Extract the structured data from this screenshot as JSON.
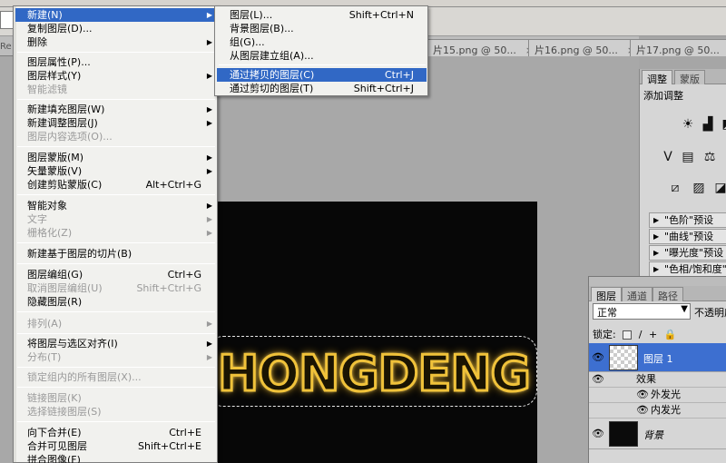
{
  "doc_tabs": [
    {
      "label": "片15.png @ 50...",
      "close": "×"
    },
    {
      "label": "片16.png @ 50...",
      "close": "×"
    },
    {
      "label": "片17.png @ 50...",
      "close": "×"
    }
  ],
  "ed_mark": "Re",
  "canvas": {
    "text": "HONGDENG"
  },
  "menu": {
    "items": [
      {
        "label": "新建(N)",
        "arrow": "▶"
      },
      {
        "label": "复制图层(D)..."
      },
      {
        "label": "删除",
        "arrow": "▶"
      },
      {
        "label": "图层属性(P)..."
      },
      {
        "label": "图层样式(Y)",
        "arrow": "▶"
      },
      {
        "label": "智能滤镜"
      },
      {
        "label": "新建填充图层(W)",
        "arrow": "▶"
      },
      {
        "label": "新建调整图层(J)",
        "arrow": "▶"
      },
      {
        "label": "图层内容选项(O)..."
      },
      {
        "label": "图层蒙版(M)",
        "arrow": "▶"
      },
      {
        "label": "矢量蒙版(V)",
        "arrow": "▶"
      },
      {
        "label": "创建剪贴蒙版(C)",
        "shortcut": "Alt+Ctrl+G"
      },
      {
        "label": "智能对象",
        "arrow": "▶"
      },
      {
        "label": "文字",
        "arrow": "▶"
      },
      {
        "label": "栅格化(Z)",
        "arrow": "▶"
      },
      {
        "label": "新建基于图层的切片(B)"
      },
      {
        "label": "图层编组(G)",
        "shortcut": "Ctrl+G"
      },
      {
        "label": "取消图层编组(U)",
        "shortcut": "Shift+Ctrl+G"
      },
      {
        "label": "隐藏图层(R)"
      },
      {
        "label": "排列(A)",
        "arrow": "▶"
      },
      {
        "label": "将图层与选区对齐(I)",
        "arrow": "▶"
      },
      {
        "label": "分布(T)",
        "arrow": "▶"
      },
      {
        "label": "锁定组内的所有图层(X)..."
      },
      {
        "label": "链接图层(K)"
      },
      {
        "label": "选择链接图层(S)"
      },
      {
        "label": "向下合并(E)",
        "shortcut": "Ctrl+E"
      },
      {
        "label": "合并可见图层",
        "shortcut": "Shift+Ctrl+E"
      },
      {
        "label": "拼合图像(F)"
      }
    ]
  },
  "submenu": {
    "items": [
      {
        "label": "图层(L)...",
        "shortcut": "Shift+Ctrl+N"
      },
      {
        "label": "背景图层(B)..."
      },
      {
        "label": "组(G)..."
      },
      {
        "label": "从图层建立组(A)..."
      },
      {
        "label": "通过拷贝的图层(C)",
        "shortcut": "Ctrl+J"
      },
      {
        "label": "通过剪切的图层(T)",
        "shortcut": "Shift+Ctrl+J"
      }
    ]
  },
  "adjustments": {
    "tabs": [
      "调整",
      "蒙版"
    ],
    "title": "添加调整",
    "icons": [
      "brightness-icon",
      "levels-icon",
      "curves-icon",
      "exposure-icon",
      "vibrance-icon",
      "hue-icon",
      "balance-icon",
      "mixer-icon",
      "gradient-map-icon"
    ],
    "icon_glyphs": [
      "☀",
      "▟",
      "◩",
      "V",
      "▤",
      "⚖",
      "▨",
      "◪",
      "⧄"
    ],
    "presets": [
      "\"色阶\"预设",
      "\"曲线\"预设",
      "\"曝光度\"预设",
      "\"色相/饱和度\"预"
    ]
  },
  "layers": {
    "tabs": [
      "图层",
      "通道",
      "路径"
    ],
    "blend_mode": "正常",
    "blend_arrow": "▼",
    "opacity_label": "不透明度",
    "lock_label": "锁定:",
    "lock_icons": [
      "/",
      "+",
      "🔒"
    ],
    "rows": [
      {
        "name": "图层 1",
        "eye": "👁"
      },
      {
        "name": "背景",
        "eye": "👁"
      }
    ],
    "effects_label": "效果",
    "effects": [
      "外发光",
      "内发光"
    ]
  }
}
